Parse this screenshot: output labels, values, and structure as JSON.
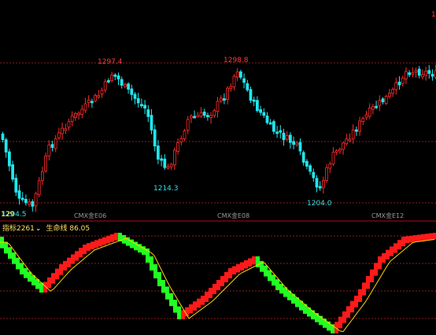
{
  "price_panel": {
    "high_labels": [
      "1297.4",
      "1298.8"
    ],
    "low_labels": [
      "1214.3",
      "1204.0"
    ],
    "left_edge_label": "1204.5",
    "left_edge_overlay": "129",
    "right_edge_label": "1",
    "contract_labels": [
      "CMX金E06",
      "CMX金E08",
      "CMX金E12"
    ],
    "colors": {
      "up": "#ff2b2b",
      "down": "#20e6ec",
      "grid": "#8b1a1a",
      "background": "#000000"
    }
  },
  "indicator_panel": {
    "name": "指标2261",
    "dropdown_icon": "chevron-down-icon",
    "line_label": "生命线",
    "line_value": "86.05",
    "colors": {
      "up": "#ff1a1a",
      "down": "#22ff22",
      "line": "#ffd400"
    }
  },
  "chart_data": {
    "type": "candlestick",
    "description_source": "price candles with upper-panel labels",
    "annotations": [
      {
        "text": "1297.4",
        "kind": "high"
      },
      {
        "text": "1298.8",
        "kind": "high"
      },
      {
        "text": "1214.3",
        "kind": "low"
      },
      {
        "text": "1204.0",
        "kind": "low"
      },
      {
        "text": "1204.5",
        "kind": "low"
      }
    ],
    "x_labels": [
      "CMX金E06",
      "CMX金E08",
      "CMX金E12"
    ]
  }
}
